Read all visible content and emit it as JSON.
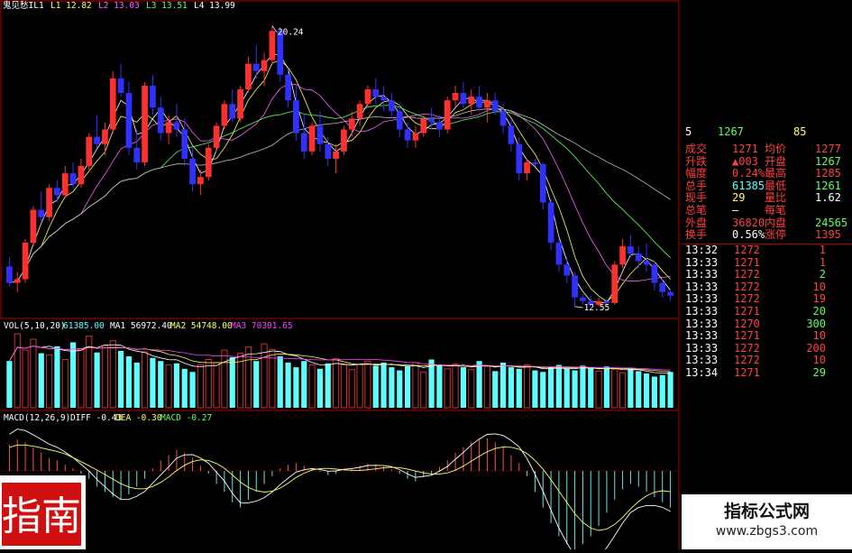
{
  "indicator_header": {
    "name": "鬼见愁IL1",
    "values": [
      {
        "label": "L1",
        "value": "12.82",
        "color": "#ffff60"
      },
      {
        "label": "L2",
        "value": "13.03",
        "color": "#ff60ff"
      },
      {
        "label": "L3",
        "value": "13.51",
        "color": "#60ff60"
      },
      {
        "label": "L4",
        "value": "13.99",
        "color": "#ffffff"
      }
    ]
  },
  "vol_header": {
    "name": "VOL(5,10,20)",
    "value": "61385.00",
    "mas": [
      {
        "label": "MA1",
        "value": "56972.40",
        "color": "#ffffff"
      },
      {
        "label": "MA2",
        "value": "54748.00",
        "color": "#ffff60"
      },
      {
        "label": "MA3",
        "value": "70301.65",
        "color": "#ff40ff"
      }
    ]
  },
  "macd_header": {
    "name": "MACD(12,26,9)",
    "items": [
      {
        "label": "DIFF",
        "value": "-0.43",
        "color": "#ffffff"
      },
      {
        "label": "DEA",
        "value": "-0.30",
        "color": "#ffff60"
      },
      {
        "label": "MACD",
        "value": "-0.27",
        "color": "#60ff60"
      }
    ]
  },
  "price_annotations": {
    "high": "20.24",
    "low": "12.55"
  },
  "quote_panel": {
    "top_row": {
      "index": "5",
      "price": "1267",
      "volume": "85"
    },
    "rows": [
      {
        "l1": "成交",
        "v1": "1271",
        "v1c": "#ff4040",
        "l2": "均价",
        "v2": "1277",
        "v2c": "#ff4040"
      },
      {
        "l1": "升跌",
        "v1": "▲003",
        "v1c": "#ff4040",
        "l2": "开盘",
        "v2": "1267",
        "v2c": "#60ff60"
      },
      {
        "l1": "幅度",
        "v1": "0.24%",
        "v1c": "#ff4040",
        "l2": "最高",
        "v2": "1285",
        "v2c": "#ff4040"
      },
      {
        "l1": "总手",
        "v1": "61385",
        "v1c": "#60ffff",
        "l2": "最低",
        "v2": "1261",
        "v2c": "#60ff60"
      },
      {
        "l1": "现手",
        "v1": "29",
        "v1c": "#ffff60",
        "l2": "量比",
        "v2": "1.62",
        "v2c": "#ffffff"
      },
      {
        "l1": "总笔",
        "v1": "—",
        "v1c": "#ffffff",
        "l2": "每笔",
        "v2": "",
        "v2c": "#ffffff"
      },
      {
        "l1": "外盘",
        "v1": "36820",
        "v1c": "#ff4040",
        "l2": "内盘",
        "v2": "24565",
        "v2c": "#60ff60"
      },
      {
        "l1": "换手",
        "v1": "0.56%",
        "v1c": "#ffffff",
        "l2": "涨停",
        "v2": "1395",
        "v2c": "#ff4040"
      }
    ],
    "ticks": [
      {
        "time": "13:32",
        "price": "1272",
        "vol": "1",
        "vc": "#ff4040"
      },
      {
        "time": "13:33",
        "price": "1271",
        "vol": "1",
        "vc": "#ff4040"
      },
      {
        "time": "13:33",
        "price": "1272",
        "vol": "2",
        "vc": "#60ff60"
      },
      {
        "time": "13:33",
        "price": "1272",
        "vol": "10",
        "vc": "#ff4040"
      },
      {
        "time": "13:33",
        "price": "1272",
        "vol": "19",
        "vc": "#ff4040"
      },
      {
        "time": "13:33",
        "price": "1271",
        "vol": "20",
        "vc": "#60ff60"
      },
      {
        "time": "13:33",
        "price": "1270",
        "vol": "300",
        "vc": "#60ff60"
      },
      {
        "time": "13:33",
        "price": "1271",
        "vol": "10",
        "vc": "#ff4040"
      },
      {
        "time": "13:33",
        "price": "1272",
        "vol": "200",
        "vc": "#ff4040"
      },
      {
        "time": "13:33",
        "price": "1272",
        "vol": "10",
        "vc": "#ff4040"
      },
      {
        "time": "13:34",
        "price": "1271",
        "vol": "29",
        "vc": "#60ff60"
      }
    ]
  },
  "watermark": {
    "title": "指标公式网",
    "url": "www.zbgs3.com"
  },
  "seal": {
    "text": "指南"
  },
  "colors": {
    "up": "#ff3030",
    "down": "#3030ff",
    "vol_up": "#d03030",
    "vol_down": "#60ffff",
    "panel_border": "#b00000",
    "macd_pos": "#ff5050",
    "macd_neg": "#70e0e0"
  },
  "chart_data": {
    "type": "candlestick",
    "title": "",
    "xlabel": "",
    "ylabel": "",
    "ylim": [
      12.3,
      20.6
    ],
    "ohlc": [
      [
        13.65,
        13.9,
        13.1,
        13.2
      ],
      [
        13.2,
        13.5,
        12.95,
        13.3
      ],
      [
        13.3,
        14.4,
        13.2,
        14.3
      ],
      [
        14.3,
        15.3,
        14.2,
        15.2
      ],
      [
        15.2,
        15.7,
        14.9,
        15.0
      ],
      [
        15.0,
        15.9,
        14.9,
        15.8
      ],
      [
        15.8,
        16.0,
        15.4,
        15.6
      ],
      [
        15.6,
        16.4,
        15.5,
        16.2
      ],
      [
        16.2,
        16.5,
        15.8,
        15.9
      ],
      [
        15.9,
        16.6,
        15.8,
        16.4
      ],
      [
        16.4,
        17.3,
        16.3,
        17.2
      ],
      [
        17.2,
        17.8,
        16.9,
        17.0
      ],
      [
        17.0,
        17.6,
        16.7,
        17.4
      ],
      [
        17.4,
        19.0,
        17.3,
        18.8
      ],
      [
        18.8,
        19.2,
        18.3,
        18.4
      ],
      [
        18.4,
        18.7,
        16.7,
        16.9
      ],
      [
        16.9,
        17.4,
        16.3,
        16.5
      ],
      [
        16.5,
        18.7,
        16.4,
        18.6
      ],
      [
        18.6,
        18.9,
        17.8,
        18.0
      ],
      [
        18.0,
        18.3,
        17.1,
        17.3
      ],
      [
        17.3,
        17.8,
        17.0,
        17.6
      ],
      [
        17.6,
        18.1,
        17.2,
        17.4
      ],
      [
        17.4,
        17.7,
        16.4,
        16.6
      ],
      [
        16.6,
        16.9,
        15.7,
        15.9
      ],
      [
        15.9,
        16.3,
        15.6,
        16.1
      ],
      [
        16.1,
        17.0,
        16.0,
        16.9
      ],
      [
        16.9,
        17.6,
        16.8,
        17.5
      ],
      [
        17.5,
        18.2,
        17.4,
        18.1
      ],
      [
        18.1,
        18.5,
        17.6,
        17.7
      ],
      [
        17.7,
        18.6,
        17.6,
        18.5
      ],
      [
        18.5,
        19.4,
        18.4,
        19.2
      ],
      [
        19.2,
        19.7,
        18.8,
        19.0
      ],
      [
        19.0,
        19.5,
        18.6,
        19.3
      ],
      [
        19.3,
        20.24,
        19.2,
        20.1
      ],
      [
        20.1,
        20.2,
        18.7,
        18.9
      ],
      [
        18.9,
        19.1,
        18.0,
        18.2
      ],
      [
        18.2,
        18.6,
        17.1,
        17.3
      ],
      [
        17.3,
        17.8,
        16.6,
        16.8
      ],
      [
        16.8,
        17.6,
        16.7,
        17.5
      ],
      [
        17.5,
        17.9,
        16.8,
        17.0
      ],
      [
        17.0,
        17.2,
        16.4,
        16.6
      ],
      [
        16.6,
        17.0,
        16.2,
        16.8
      ],
      [
        16.8,
        17.5,
        16.7,
        17.4
      ],
      [
        17.4,
        17.9,
        17.2,
        17.7
      ],
      [
        17.7,
        18.2,
        17.5,
        18.1
      ],
      [
        18.1,
        18.6,
        18.0,
        18.5
      ],
      [
        18.5,
        18.8,
        18.1,
        18.3
      ],
      [
        18.3,
        18.6,
        17.9,
        18.2
      ],
      [
        18.2,
        18.4,
        17.7,
        17.9
      ],
      [
        17.9,
        18.1,
        17.2,
        17.4
      ],
      [
        17.4,
        17.6,
        16.9,
        17.1
      ],
      [
        17.1,
        17.5,
        16.9,
        17.3
      ],
      [
        17.3,
        17.8,
        17.2,
        17.7
      ],
      [
        17.7,
        18.0,
        17.4,
        17.6
      ],
      [
        17.6,
        17.8,
        17.2,
        17.4
      ],
      [
        17.4,
        18.3,
        17.3,
        18.2
      ],
      [
        18.2,
        18.6,
        18.0,
        18.4
      ],
      [
        18.4,
        18.7,
        18.0,
        18.1
      ],
      [
        18.1,
        18.5,
        17.8,
        18.3
      ],
      [
        18.3,
        18.6,
        17.9,
        18.0
      ],
      [
        18.0,
        18.4,
        17.6,
        18.2
      ],
      [
        18.2,
        18.4,
        17.8,
        17.9
      ],
      [
        17.9,
        18.1,
        17.3,
        17.5
      ],
      [
        17.5,
        17.7,
        16.8,
        17.0
      ],
      [
        17.0,
        17.2,
        16.0,
        16.2
      ],
      [
        16.2,
        16.6,
        16.0,
        16.5
      ],
      [
        16.5,
        16.6,
        16.4,
        16.45
      ],
      [
        16.45,
        16.5,
        15.2,
        15.4
      ],
      [
        15.4,
        15.5,
        14.1,
        14.3
      ],
      [
        14.3,
        14.4,
        13.5,
        13.7
      ],
      [
        13.7,
        13.9,
        13.2,
        13.4
      ],
      [
        13.4,
        13.5,
        12.55,
        12.8
      ],
      [
        12.8,
        12.9,
        12.6,
        12.7
      ],
      [
        12.7,
        12.85,
        12.55,
        12.6
      ],
      [
        12.6,
        12.8,
        12.55,
        12.7
      ],
      [
        12.7,
        12.75,
        12.6,
        12.65
      ],
      [
        12.65,
        13.8,
        12.6,
        13.7
      ],
      [
        13.7,
        14.4,
        13.6,
        14.2
      ],
      [
        14.2,
        14.5,
        13.9,
        14.0
      ],
      [
        14.0,
        14.2,
        13.6,
        13.8
      ],
      [
        13.8,
        14.3,
        13.5,
        13.7
      ],
      [
        13.7,
        13.8,
        13.0,
        13.2
      ],
      [
        13.2,
        13.3,
        12.8,
        12.95
      ],
      [
        12.95,
        13.05,
        12.7,
        12.85
      ]
    ],
    "volume": [
      60,
      95,
      74,
      88,
      70,
      68,
      79,
      62,
      84,
      76,
      92,
      71,
      80,
      86,
      73,
      66,
      58,
      72,
      64,
      60,
      55,
      57,
      50,
      46,
      55,
      62,
      58,
      74,
      65,
      70,
      78,
      60,
      82,
      75,
      66,
      58,
      52,
      60,
      55,
      50,
      57,
      63,
      55,
      49,
      56,
      60,
      54,
      58,
      52,
      48,
      54,
      58,
      46,
      62,
      55,
      50,
      56,
      52,
      49,
      60,
      53,
      47,
      58,
      52,
      50,
      55,
      48,
      46,
      52,
      55,
      50,
      48,
      54,
      51,
      47,
      53,
      49,
      45,
      50,
      47,
      44,
      40,
      42,
      46
    ],
    "macd_hist": [
      0.5,
      0.6,
      0.55,
      0.45,
      0.35,
      0.25,
      0.2,
      0.12,
      0.05,
      -0.05,
      -0.15,
      -0.3,
      -0.4,
      -0.5,
      -0.55,
      -0.45,
      -0.3,
      -0.15,
      0.05,
      0.2,
      0.3,
      0.4,
      0.35,
      0.25,
      0.1,
      -0.05,
      -0.25,
      -0.4,
      -0.6,
      -0.7,
      -0.55,
      -0.4,
      -0.25,
      -0.1,
      0.05,
      0.12,
      0.15,
      0.1,
      0.05,
      -0.02,
      -0.08,
      -0.05,
      0.02,
      0.06,
      0.1,
      0.14,
      0.12,
      0.08,
      0.03,
      -0.05,
      -0.15,
      -0.2,
      -0.12,
      -0.05,
      0.08,
      0.2,
      0.35,
      0.45,
      0.55,
      0.6,
      0.62,
      0.55,
      0.45,
      0.3,
      0.15,
      -0.1,
      -0.4,
      -0.7,
      -1.0,
      -1.25,
      -1.4,
      -1.5,
      -1.4,
      -1.25,
      -1.05,
      -0.8,
      -0.55,
      -0.35,
      -0.25,
      -0.3,
      -0.4,
      -0.5,
      -0.6,
      -0.7
    ]
  }
}
